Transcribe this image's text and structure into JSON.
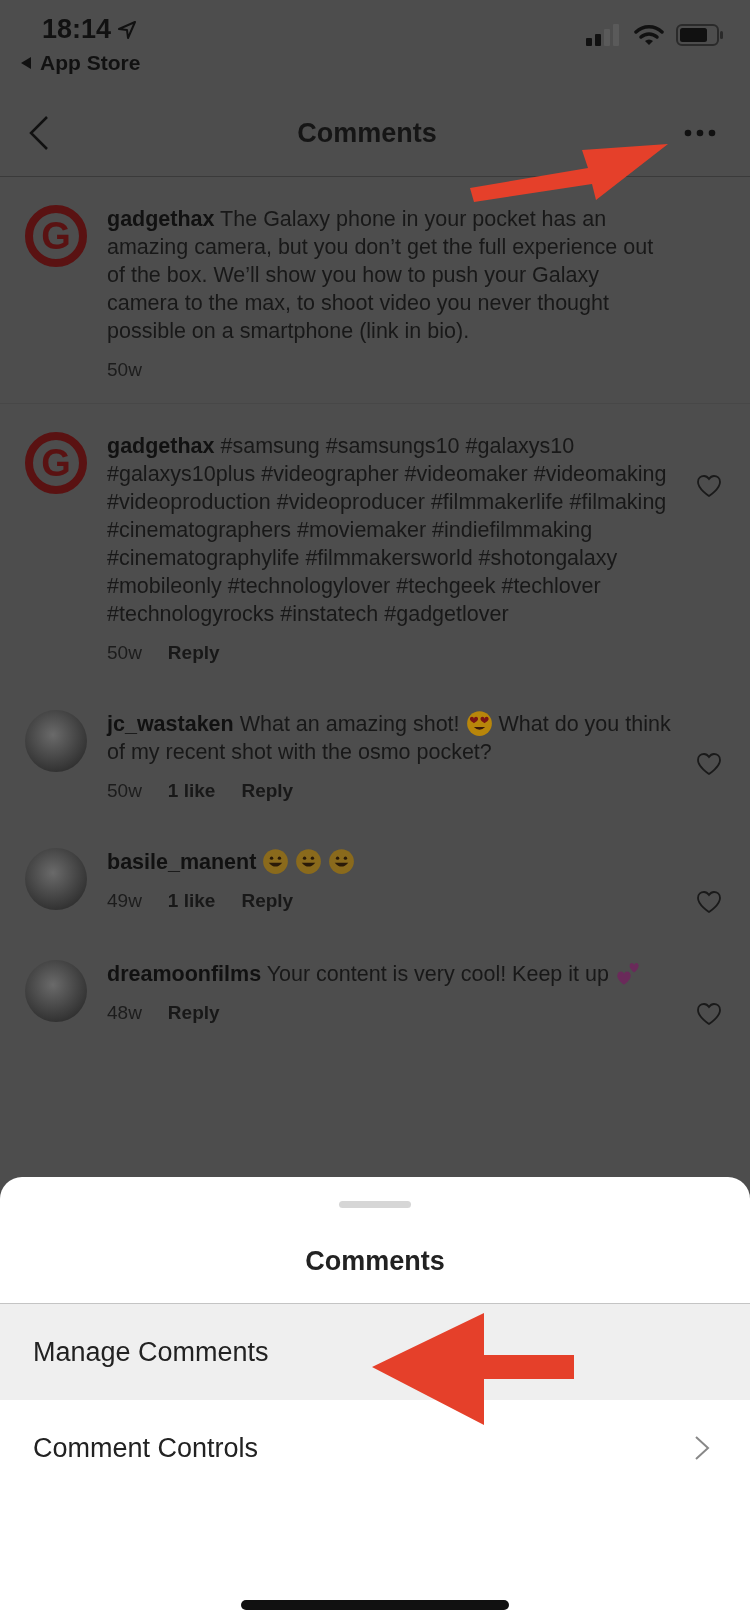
{
  "status_bar": {
    "time": "18:14",
    "back_app": "App Store"
  },
  "header": {
    "title": "Comments"
  },
  "caption": {
    "username": "gadgethax",
    "avatar_letter": "G",
    "segments": [
      {
        "kind": "text",
        "text": "The Galaxy phone in your pocket has an amazing camera, but you don’t get the full experience out of the box. We’ll show you how to push your Galaxy camera to the max, to shoot video you never thought possible on a smartphone (link in bio)."
      }
    ],
    "meta": [
      "50w"
    ]
  },
  "comments": [
    {
      "username": "gadgethax",
      "avatar_letter": "G",
      "segments": [
        {
          "kind": "text",
          "text": "#samsung #samsungs10 #galaxys10 #galaxys10plus #videographer #videomaker #videomaking #videoproduction #videoproducer #filmmakerlife #filmaking #cinematographers #moviemaker #indiefilmmaking #cinematographylife #filmmakersworld #shotongalaxy #mobileonly #technologylover #techgeek #techlover #technologyrocks #instatech #gadgetlover"
        }
      ],
      "meta": [
        "50w",
        "Reply"
      ]
    },
    {
      "username": "jc_wastaken",
      "segments": [
        {
          "kind": "text",
          "text": "What an amazing shot!"
        },
        {
          "kind": "heart_eyes"
        },
        {
          "kind": "text",
          "text": "What do you think of my recent shot with the osmo pocket?"
        }
      ],
      "meta": [
        "50w",
        "1 like",
        "Reply"
      ]
    },
    {
      "username": "basile_manent",
      "segments": [
        {
          "kind": "grin"
        },
        {
          "kind": "grin"
        },
        {
          "kind": "grin"
        }
      ],
      "meta": [
        "49w",
        "1 like",
        "Reply"
      ]
    },
    {
      "username": "dreamoonfilms",
      "segments": [
        {
          "kind": "text",
          "text": "Your content is very cool! Keep it up"
        },
        {
          "kind": "hearts"
        }
      ],
      "meta": [
        "48w",
        "Reply"
      ]
    }
  ],
  "sheet": {
    "title": "Comments",
    "items": [
      {
        "label": "Manage Comments",
        "selected": true,
        "chevron": false
      },
      {
        "label": "Comment Controls",
        "selected": false,
        "chevron": true
      }
    ]
  }
}
